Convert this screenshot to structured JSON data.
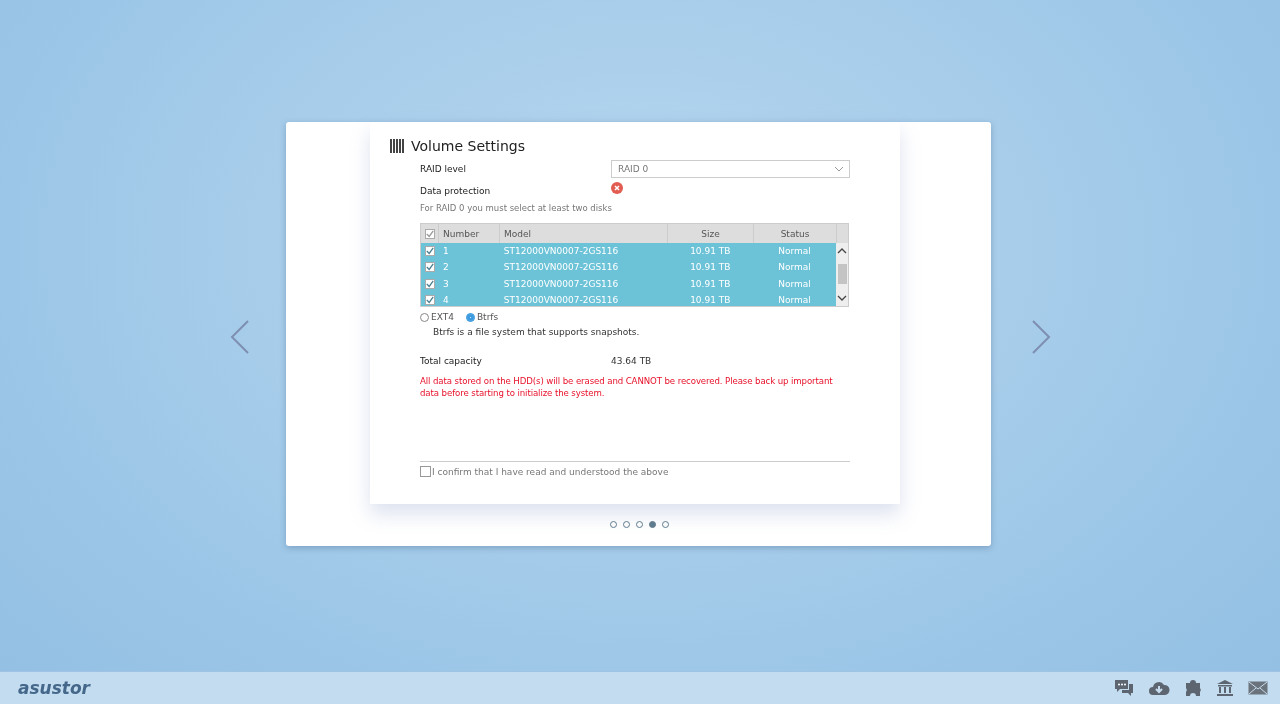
{
  "dialog": {
    "title": "Volume Settings",
    "raid_level": {
      "label": "RAID level",
      "value": "RAID 0"
    },
    "data_protection": {
      "label": "Data protection",
      "on": false
    },
    "hint": "For RAID 0 you must select at least two disks",
    "disk_table": {
      "all_checked": true,
      "columns": [
        "Number",
        "Model",
        "Size",
        "Status"
      ],
      "rows": [
        {
          "checked": true,
          "selected": true,
          "cells": [
            "1",
            "ST12000VN0007-2GS116",
            "10.91 TB",
            "Normal"
          ]
        },
        {
          "checked": true,
          "selected": true,
          "cells": [
            "2",
            "ST12000VN0007-2GS116",
            "10.91 TB",
            "Normal"
          ]
        },
        {
          "checked": true,
          "selected": true,
          "cells": [
            "3",
            "ST12000VN0007-2GS116",
            "10.91 TB",
            "Normal"
          ]
        },
        {
          "checked": true,
          "selected": true,
          "cells": [
            "4",
            "ST12000VN0007-2GS116",
            "10.91 TB",
            "Normal"
          ]
        }
      ]
    },
    "file_systems": [
      {
        "label": "EXT4",
        "selected": false
      },
      {
        "label": "Btrfs",
        "selected": true
      }
    ],
    "fs_description": "Btrfs is a file system that supports snapshots.",
    "total_capacity": {
      "label": "Total capacity",
      "value": "43.64 TB"
    },
    "warning": "All data stored on the HDD(s) will be erased and CANNOT be recovered. Please back up important data before starting to initialize the system.",
    "confirm": {
      "label": "I confirm that I have read and understood the above",
      "checked": false
    },
    "pages": [
      {
        "selected": false
      },
      {
        "selected": false
      },
      {
        "selected": false
      },
      {
        "selected": true
      },
      {
        "selected": false
      }
    ]
  },
  "taskbar": {
    "logo": "asustor"
  }
}
